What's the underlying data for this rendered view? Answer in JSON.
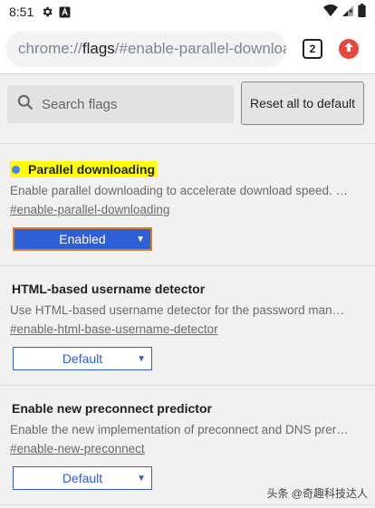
{
  "status_bar": {
    "time": "8:51"
  },
  "toolbar": {
    "url_scheme": "chrome://",
    "url_host": "flags",
    "url_path": "/#enable-parallel-downloa",
    "tab_count": "2"
  },
  "search": {
    "placeholder": "Search flags",
    "reset_label": "Reset all to default"
  },
  "flags": [
    {
      "title": "Parallel downloading",
      "description": "Enable parallel downloading to accelerate download speed. – …",
      "link": "#enable-parallel-downloading",
      "value": "Enabled"
    },
    {
      "title": "HTML-based username detector",
      "description": "Use HTML-based username detector for the password manag…",
      "link": "#enable-html-base-username-detector",
      "value": "Default"
    },
    {
      "title": "Enable new preconnect predictor",
      "description": "Enable the new implementation of preconnect and DNS preres…",
      "link": "#enable-new-preconnect",
      "value": "Default"
    }
  ],
  "watermark": "头条 @奇趣科技达人",
  "colors": {
    "accent": "#2f5fd6",
    "highlight": "#ffff00",
    "update": "#e8453c"
  }
}
